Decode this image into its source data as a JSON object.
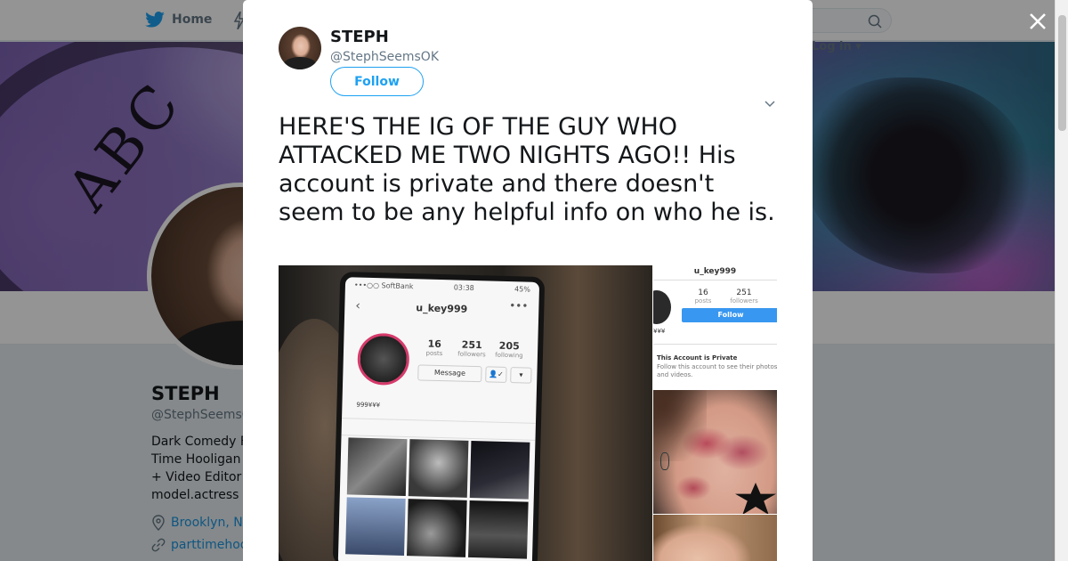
{
  "topbar": {
    "home_label": "Home",
    "login_label": "Log in ▾",
    "brand_color": "#1da1f2"
  },
  "profile": {
    "name": "STEPH",
    "handle": "@StephSeemsOK",
    "bio_lines": [
      "Dark Comedy F",
      "Time Hooligan",
      "+ Video Editor",
      "model.actress"
    ],
    "location": "Brooklyn, N",
    "website": "parttimehoo"
  },
  "tweet": {
    "author_name": "STEPH",
    "author_handle": "@StephSeemsOK",
    "follow_label": "Follow",
    "text": "HERE'S THE IG OF THE GUY WHO ATTACKED ME TWO NIGHTS AGO!! His account is private and there doesn't seem to be any helpful info on who he is."
  },
  "media": {
    "phone_screen": {
      "carrier": "•••○○ SoftBank",
      "time": "03:38",
      "battery": "45%",
      "username": "u_key999",
      "posts": "16",
      "posts_label": "posts",
      "followers": "251",
      "followers_label": "followers",
      "following": "205",
      "following_label": "following",
      "message_label": "Message",
      "bio": "999¥¥¥"
    },
    "screenshot": {
      "username": "u_key999",
      "posts": "16",
      "posts_label": "posts",
      "followers": "251",
      "followers_label": "followers",
      "follow_label": "Follow",
      "bio": "¥¥¥",
      "private_title": "This Account is Private",
      "private_sub": "Follow this account to see their photos and videos."
    }
  },
  "icons": {
    "bird": "twitter-bird-icon",
    "search": "search-icon",
    "close": "close-icon",
    "caret": "chevron-down-icon",
    "location": "location-pin-icon",
    "link": "link-icon"
  }
}
